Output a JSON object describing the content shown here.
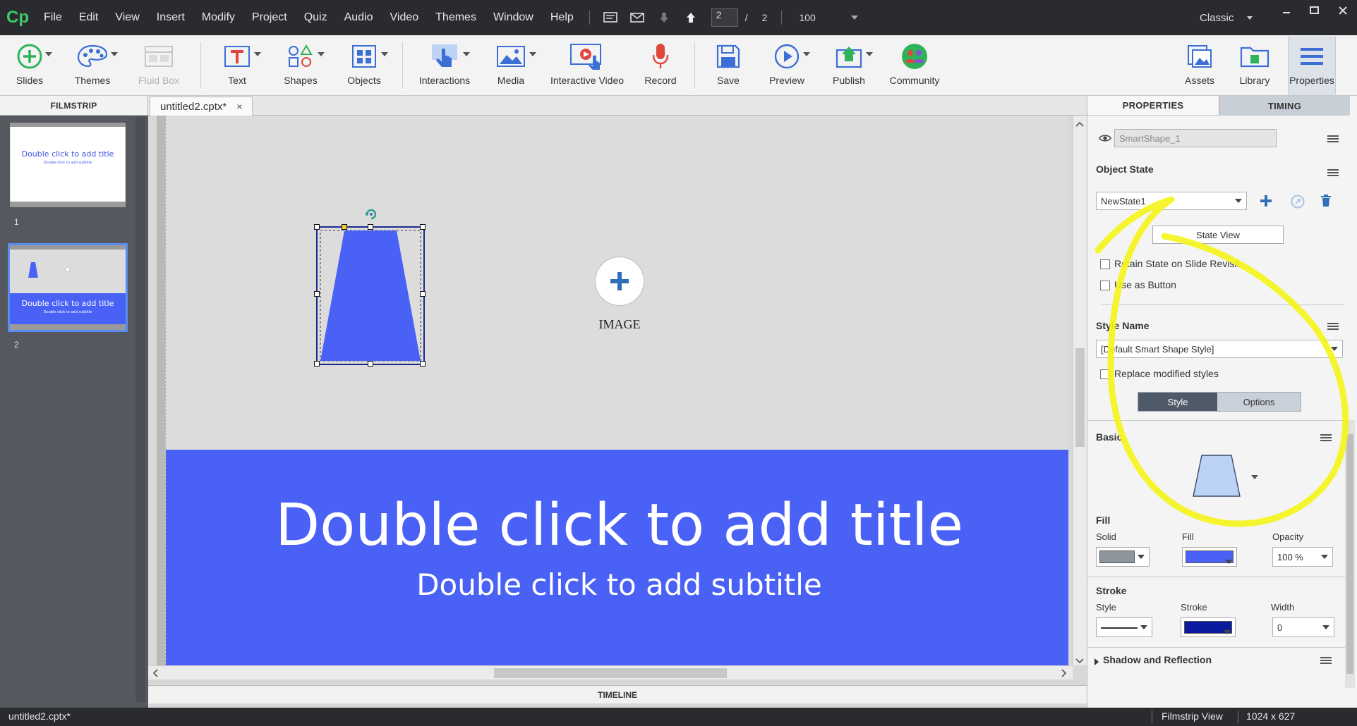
{
  "app": {
    "logo": "Cp",
    "layout_mode": "Classic"
  },
  "menu": [
    "File",
    "Edit",
    "View",
    "Insert",
    "Modify",
    "Project",
    "Quiz",
    "Audio",
    "Video",
    "Themes",
    "Window",
    "Help"
  ],
  "navigation": {
    "current_slide": "2",
    "separator": "/",
    "total_slides": "2",
    "zoom": "100"
  },
  "toolbar": {
    "slides": "Slides",
    "themes": "Themes",
    "fluid_box": "Fluid Box",
    "text": "Text",
    "shapes": "Shapes",
    "objects": "Objects",
    "interactions": "Interactions",
    "media": "Media",
    "interactive_video": "Interactive Video",
    "record": "Record",
    "save": "Save",
    "preview": "Preview",
    "publish": "Publish",
    "community": "Community",
    "assets": "Assets",
    "library": "Library",
    "properties": "Properties"
  },
  "filmstrip": {
    "header": "FILMSTRIP",
    "slides": [
      {
        "number": "1",
        "title": "Double click to add title",
        "subtitle": "Double click to add subtitle"
      },
      {
        "number": "2",
        "title": "Double click to add title",
        "subtitle": "Double click to add subtitle"
      }
    ]
  },
  "editor": {
    "tab_name": "untitled2.cptx*",
    "tab_close": "×",
    "slide_title": "Double click to add title",
    "slide_subtitle": "Double click to add subtitle",
    "image_label": "IMAGE",
    "timeline": "TIMELINE"
  },
  "properties": {
    "tabs": [
      "PROPERTIES",
      "TIMING"
    ],
    "object_name": "SmartShape_1",
    "object_state_heading": "Object State",
    "state_value": "NewState1",
    "state_view_button": "State View",
    "retain_state": "Retain State on Slide Revisit",
    "use_as_button": "Use as Button",
    "style_name_heading": "Style Name",
    "style_value": "[Default Smart Shape Style]",
    "replace_modified": "Replace modified styles",
    "style_tab": "Style",
    "options_tab": "Options",
    "basic_heading": "Basic",
    "fill_heading": "Fill",
    "fill_labels": {
      "solid": "Solid",
      "fill": "Fill",
      "opacity": "Opacity"
    },
    "opacity_value": "100 %",
    "stroke_heading": "Stroke",
    "stroke_labels": {
      "style": "Style",
      "stroke": "Stroke",
      "width": "Width"
    },
    "width_value": "0",
    "shadow_heading": "Shadow and Reflection"
  },
  "statusbar": {
    "file": "untitled2.cptx*",
    "view": "Filmstrip View",
    "dimensions": "1024 x 627"
  },
  "colors": {
    "slide_blue": "#4a61f5",
    "shape_fill": "#4a61f5",
    "stroke_color": "#0a1a9e",
    "solid_swatch": "#8e959d",
    "accent_green": "#3ec96a",
    "annotation_yellow": "#f5f51a"
  }
}
